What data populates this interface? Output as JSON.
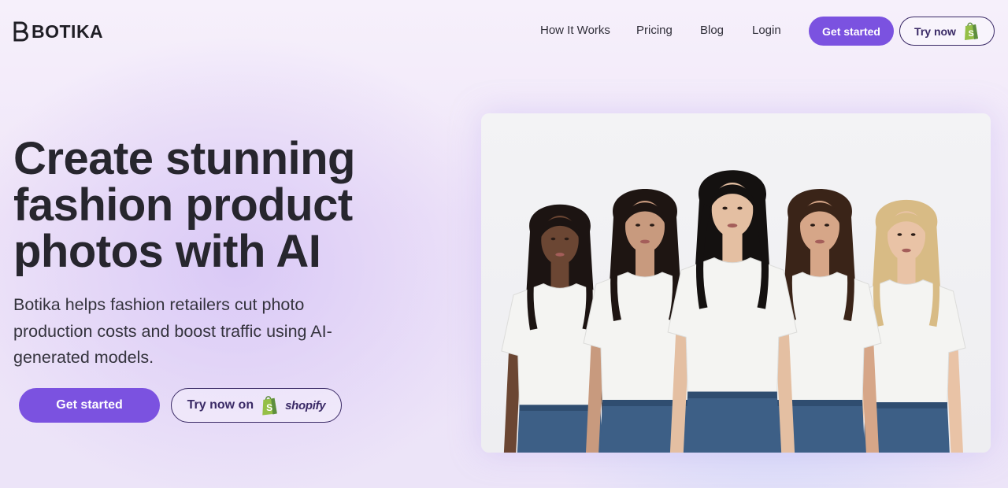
{
  "brand": {
    "name": "BOTIKA"
  },
  "nav": {
    "items": [
      "How It Works",
      "Pricing",
      "Blog",
      "Login"
    ],
    "get_started": "Get started",
    "try_now": "Try now"
  },
  "hero": {
    "headline": "Create stunning fashion product photos with AI",
    "subhead": "Botika helps fashion retailers cut photo production costs and boost traffic using AI-generated models.",
    "cta_primary": "Get started",
    "cta_secondary": "Try now on",
    "cta_secondary_brand": "shopify"
  },
  "image": {
    "subject": "five female models in white t-shirts and blue jeans",
    "hair_colors": [
      "#1c1412",
      "#1e1512",
      "#d8bb85",
      "#141110",
      "#3a2418"
    ],
    "skin_tones": [
      "#6b4633",
      "#c89a7e",
      "#e9c3a6",
      "#e4bfa2",
      "#d6a688"
    ]
  },
  "colors": {
    "accent": "#7b52e0",
    "outline": "#3a2a66",
    "shopify_green": "#95bf47"
  },
  "icons": [
    "logo-b-icon",
    "shopify-bag-icon"
  ]
}
